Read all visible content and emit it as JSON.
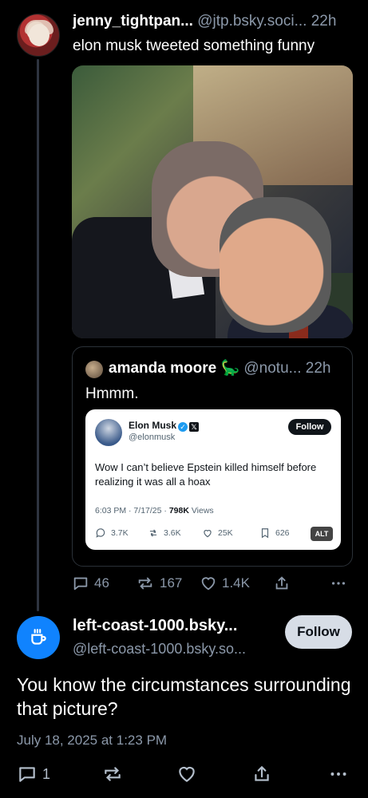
{
  "post1": {
    "display_name": "jenny_tightpan...",
    "handle": "@jtp.bsky.soci...",
    "time": "22h",
    "text": "elon musk tweeted something funny",
    "stats": {
      "replies": "46",
      "reposts": "167",
      "likes": "1.4K"
    }
  },
  "quote": {
    "display_name": "amanda moore",
    "emoji": "🦕",
    "handle": "@notu...",
    "time": "22h",
    "text": "Hmmm.",
    "tweet": {
      "name": "Elon Musk",
      "handle": "@elonmusk",
      "follow_label": "Follow",
      "body": "Wow I can’t believe Epstein killed himself before realizing it was all a hoax",
      "time": "6:03 PM · 7/17/25 · ",
      "views": "798K",
      "views_label": " Views",
      "replies": "3.7K",
      "retweets": "3.6K",
      "likes": "25K",
      "bookmarks": "626",
      "alt_label": "ALT"
    }
  },
  "post2": {
    "display_name": "left-coast-1000.bsky...",
    "handle": "@left-coast-1000.bsky.so...",
    "follow_label": "Follow",
    "text": "You know the circumstances surrounding that picture?",
    "date": "July 18, 2025 at 1:23 PM",
    "stats": {
      "replies": "1"
    }
  },
  "colors": {
    "accent": "#1083fe",
    "muted": "#8b98a9",
    "background": "#000000"
  }
}
